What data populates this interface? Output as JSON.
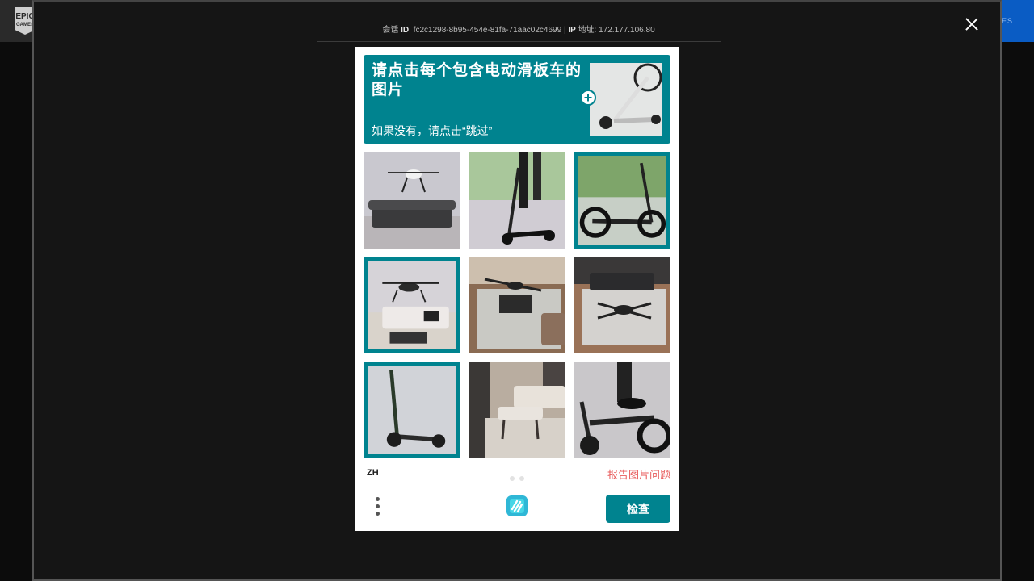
{
  "background": {
    "logo_text_top": "EPIC",
    "logo_text_bottom": "GAMES",
    "corner_link": "IES"
  },
  "meta": {
    "id_prefix": "会话",
    "id_label": "ID",
    "id_value": ": fc2c1298-8b95-454e-81fa-71aac02c4699 | ",
    "ip_label": "IP",
    "ip_suffix": " 地址: 172.177.106.80"
  },
  "captcha": {
    "prompt_title": "请点击每个包含电动滑板车的图片",
    "prompt_sub": "如果没有，请点击“跳过”",
    "tiles": [
      {
        "subject": "drone-over-sofa",
        "selected": false
      },
      {
        "subject": "scooter-rider",
        "selected": false
      },
      {
        "subject": "scooter-grass",
        "selected": true
      },
      {
        "subject": "drone-living-room",
        "selected": true
      },
      {
        "subject": "drone-on-rug",
        "selected": false
      },
      {
        "subject": "drone-room-floor",
        "selected": false
      },
      {
        "subject": "scooter-standing",
        "selected": true
      },
      {
        "subject": "room-bench",
        "selected": false
      },
      {
        "subject": "scooter-rider-closeup",
        "selected": false
      }
    ],
    "language": "ZH",
    "report_link": "报告图片问题",
    "submit_label": "检查"
  },
  "colors": {
    "accent": "#00838f",
    "report": "#e85b5b",
    "overlay_bg": "#151515"
  }
}
